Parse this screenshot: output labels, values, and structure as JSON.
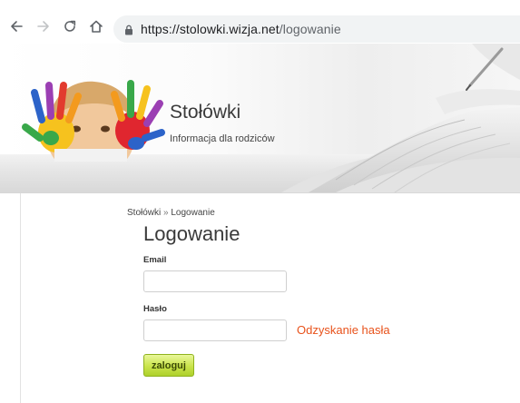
{
  "browser": {
    "url_host": "https://stolowki.wizja.net",
    "url_path": "/logowanie"
  },
  "site": {
    "title": "Stołówki",
    "subtitle": "Informacja dla rodziców"
  },
  "breadcrumb": {
    "home": "Stołówki",
    "separator": "»",
    "current": "Logowanie"
  },
  "login": {
    "heading": "Logowanie",
    "email_label": "Email",
    "email_value": "",
    "password_label": "Hasło",
    "password_value": "",
    "recover_link": "Odzyskanie hasła",
    "submit_label": "zaloguj"
  },
  "colors": {
    "link_accent": "#e8521b",
    "button_green": "#c9e44a"
  }
}
